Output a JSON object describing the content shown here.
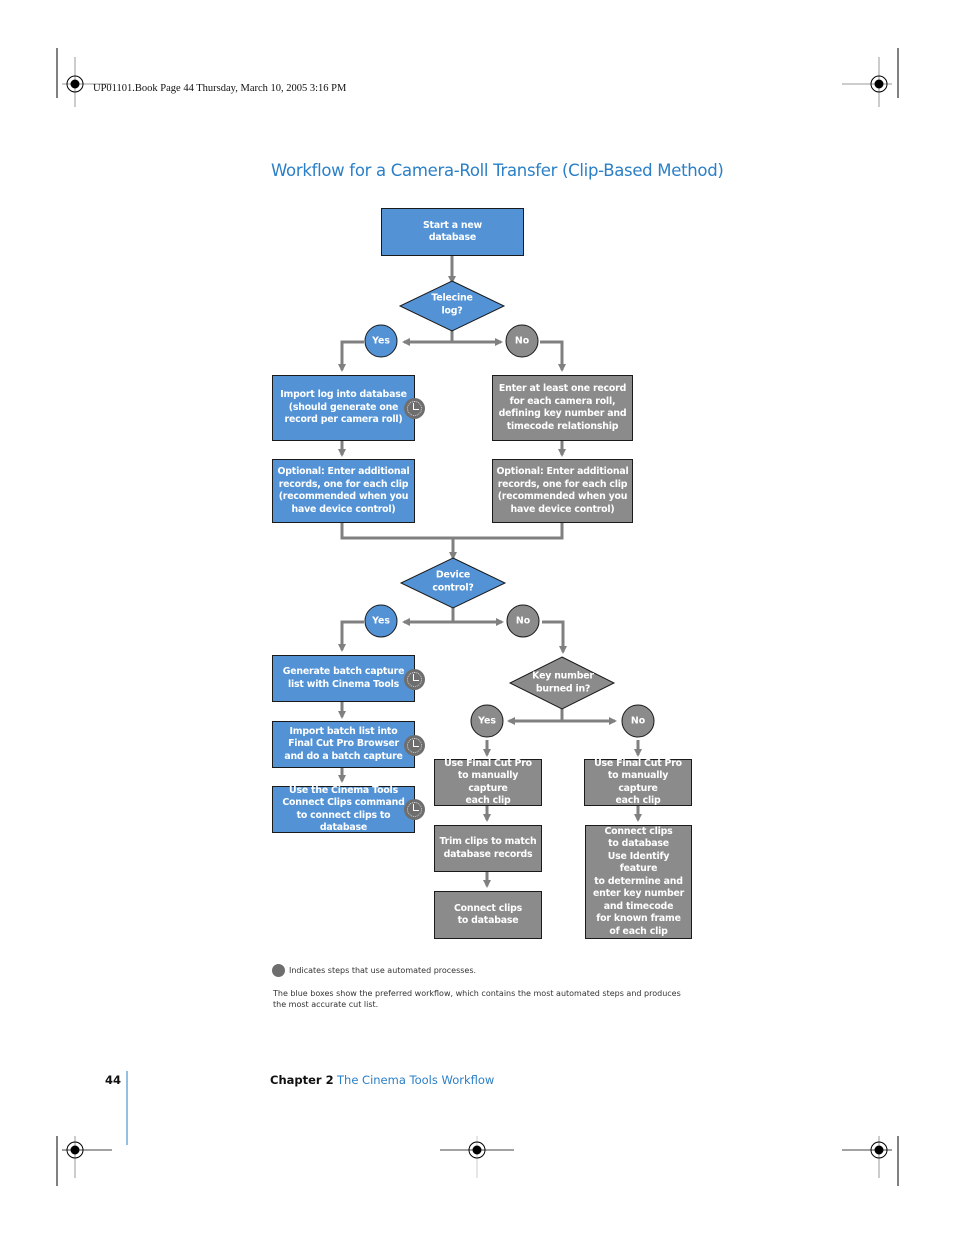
{
  "slug": "UP01101.Book  Page 44  Thursday, March 10, 2005  3:16 PM",
  "title": "Workflow for a Camera-Roll Transfer (Clip-Based Method)",
  "colors": {
    "preferred": "#5393d5",
    "alternate": "#8c8b8b",
    "connector": "#808080",
    "title": "#2a7fc6"
  },
  "nodes": {
    "start": "Start a new\ndatabase",
    "telecine_decision": "Telecine\nlog?",
    "telecine_yes": "Yes",
    "telecine_no": "No",
    "import_log": "Import log into database\n(should generate one\nrecord per camera roll)",
    "enter_record": "Enter at least one record\nfor each camera roll,\ndefining key number and\ntimecode relationship",
    "optional_blue": "Optional: Enter additional\nrecords, one for each clip\n(recommended when you\nhave device control)",
    "optional_gray": "Optional: Enter additional\nrecords, one for each clip\n(recommended when you\nhave device control)",
    "device_decision": "Device\ncontrol?",
    "device_yes": "Yes",
    "device_no": "No",
    "generate_batch": "Generate batch capture\nlist with Cinema Tools",
    "import_batch": "Import batch list into\nFinal Cut Pro Browser\nand do a batch capture",
    "connect_command": "Use the Cinema Tools\nConnect Clips command\nto connect clips to database",
    "keynum_decision": "Key number\nburned in?",
    "keynum_yes": "Yes",
    "keynum_no": "No",
    "manual_capture_yes": "Use Final Cut Pro\nto manually capture\neach clip",
    "trim_clips": "Trim clips to match\ndatabase records",
    "connect_yes": "Connect clips\nto database",
    "manual_capture_no": "Use Final Cut Pro\nto manually capture\neach clip",
    "connect_identify": "Connect clips\nto database\nUse Identify feature\nto determine and\nenter key number\nand timecode\nfor known frame\nof each clip"
  },
  "legend": {
    "icon": "clock-icon",
    "text": "Indicates steps that use automated processes."
  },
  "note": "The blue boxes show the preferred workflow, which contains the most automated steps and produces the most accurate cut list.",
  "footer": {
    "page_number": "44",
    "chapter": "Chapter 2",
    "chapter_title": "The Cinema Tools Workflow"
  }
}
